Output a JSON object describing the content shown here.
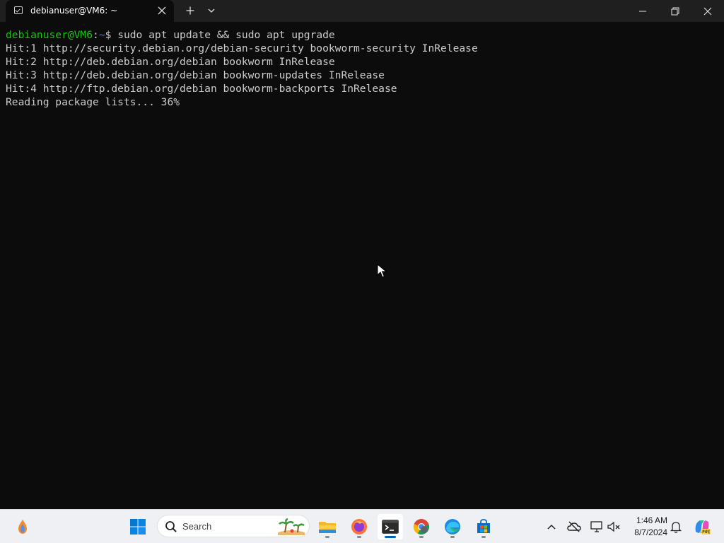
{
  "window": {
    "tab_title": "debianuser@VM6: ~"
  },
  "terminal": {
    "prompt_user": "debianuser@VM6",
    "prompt_sep": ":",
    "prompt_path": "~",
    "prompt_symbol": "$ ",
    "command": "sudo apt update && sudo apt upgrade",
    "output": [
      "Hit:1 http://security.debian.org/debian-security bookworm-security InRelease",
      "Hit:2 http://deb.debian.org/debian bookworm InRelease",
      "Hit:3 http://deb.debian.org/debian bookworm-updates InRelease",
      "Hit:4 http://ftp.debian.org/debian bookworm-backports InRelease",
      "Reading package lists... 36%"
    ]
  },
  "taskbar": {
    "search_label": "Search",
    "clock_time": "1:46 AM",
    "clock_date": "8/7/2024",
    "apps": [
      "widgets-icon",
      "start-icon",
      "file-explorer-icon",
      "firefox-icon",
      "terminal-icon",
      "chrome-icon",
      "edge-icon",
      "store-icon"
    ],
    "active_app": "terminal-icon"
  },
  "colors": {
    "prompt_user": "#16c60c",
    "prompt_path": "#3b78ff",
    "terminal_bg": "#0c0c0c",
    "terminal_fg": "#cccccc",
    "accent": "#0067c0"
  }
}
